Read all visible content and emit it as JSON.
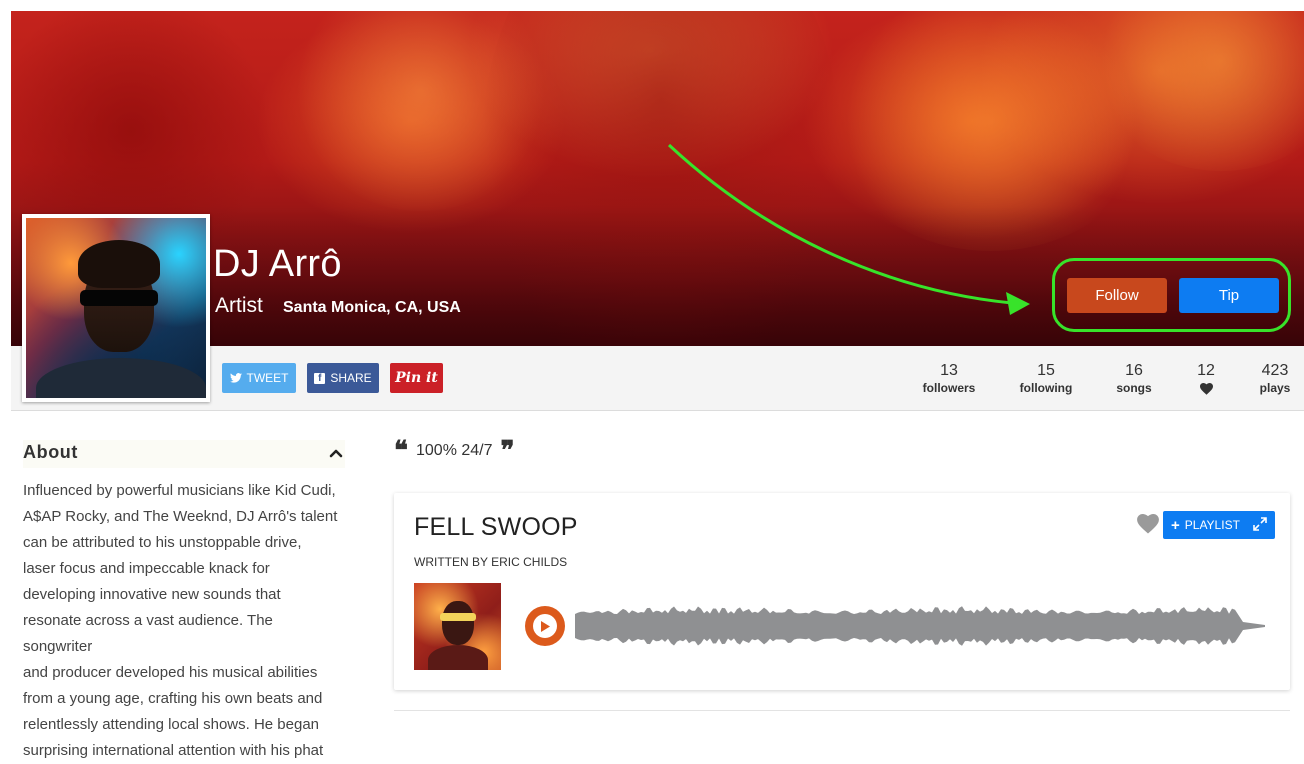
{
  "profile": {
    "name": "DJ Arrô",
    "role": "Artist",
    "location": "Santa Monica, CA, USA"
  },
  "actions": {
    "follow_label": "Follow",
    "tip_label": "Tip"
  },
  "social": {
    "tweet_label": "TWEET",
    "share_label": "SHARE",
    "pin_label": "Pin it"
  },
  "stats": [
    {
      "value": "13",
      "label": "followers"
    },
    {
      "value": "15",
      "label": "following"
    },
    {
      "value": "16",
      "label": "songs"
    },
    {
      "value": "12",
      "label": "heart-icon"
    },
    {
      "value": "423",
      "label": "plays"
    }
  ],
  "about": {
    "title": "About",
    "lines": [
      "Influenced by powerful musicians like Kid Cudi,",
      "A$AP Rocky, and The Weeknd, DJ Arrô's talent",
      "can be attributed to his unstoppable drive,",
      "laser focus and impeccable knack for",
      "developing innovative new sounds that",
      "resonate across a vast audience. The songwriter",
      "and producer developed his musical abilities",
      "from a young age, crafting his own beats and",
      "relentlessly attending local shows. He began",
      "surprising international attention with his phat"
    ]
  },
  "quote": {
    "text": "100% 24/7"
  },
  "song": {
    "title": "FELL SWOOP",
    "writer": "WRITTEN BY ERIC CHILDS",
    "playlist_label": "PLAYLIST"
  },
  "colors": {
    "follow": "#c8481d",
    "tip": "#0d7cf2",
    "highlight": "#38e32a",
    "play": "#dc5a1c"
  }
}
